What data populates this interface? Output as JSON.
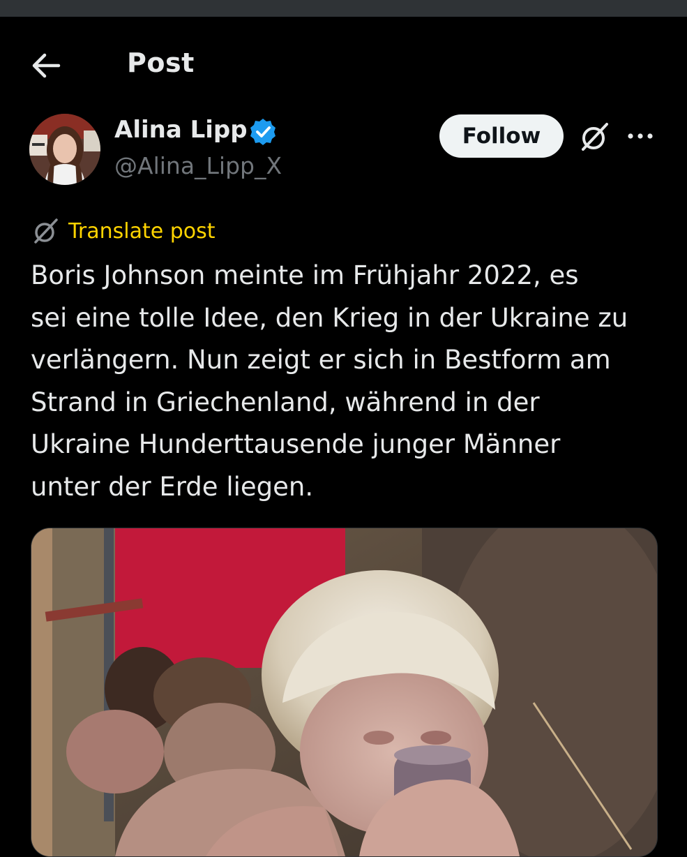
{
  "header": {
    "title": "Post",
    "back_icon": "arrow-left-icon"
  },
  "author": {
    "name": "Alina Lipp",
    "handle": "@Alina_Lipp_X",
    "verified": true,
    "verified_color": "#1d9bf0",
    "follow_label": "Follow"
  },
  "actions": {
    "grok_icon": "grok-icon",
    "more_icon": "more-horizontal-icon"
  },
  "translate": {
    "label": "Translate post",
    "color": "#ffd400"
  },
  "post": {
    "lines": [
      "Boris Johnson meinte im Frühjahr 2022, es",
      "sei eine tolle Idee, den Krieg in der Ukraine zu",
      "verlängern. Nun zeigt er sich in Bestform am",
      "Strand in Griechenland, während in der",
      "Ukraine Hunderttausende junger Männer",
      "unter der Erde liegen."
    ]
  },
  "colors": {
    "background": "#000000",
    "text_primary": "#e7e9ea",
    "text_secondary": "#71767b",
    "follow_bg": "#eff3f4"
  }
}
